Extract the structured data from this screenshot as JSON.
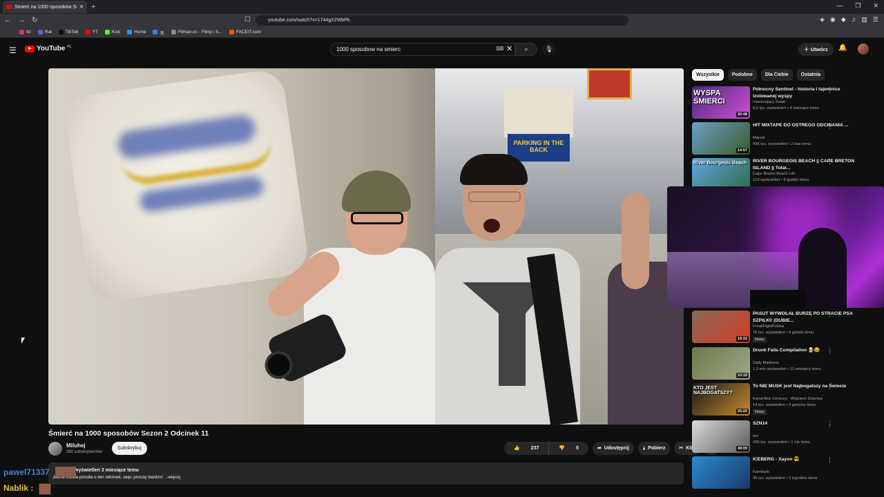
{
  "browser": {
    "tab_title": "Śmierć na 1000 sposobów Se",
    "url": "youtube.com/watch?v=1744gX2WbPk",
    "bookmarks": [
      {
        "label": "IG",
        "color": "#e1306c"
      },
      {
        "label": "Rat",
        "color": "#6a5acd"
      },
      {
        "label": "TikTok",
        "color": "#111111"
      },
      {
        "label": "YT",
        "color": "#ff0000"
      },
      {
        "label": "Kick",
        "color": "#53fc18"
      },
      {
        "label": "Home",
        "color": "#1d9bf0"
      },
      {
        "label": "天",
        "color": "#3b82f6"
      },
      {
        "label": "Filman.cc - Filmy i S...",
        "color": "#888888"
      },
      {
        "label": "FACEIT.com",
        "color": "#ff5500"
      }
    ]
  },
  "yt": {
    "logo": "YouTube",
    "region": "PL",
    "search_value": "1000 sposobow na smierc",
    "create_label": "Utwórz"
  },
  "video": {
    "sign_text": "PARKING IN THE BACK",
    "title": "Śmierć na 1000 sposobów Sezon 2 Odcinek 11",
    "channel": "Miluhej",
    "subscribers": "392 subskrybentów",
    "subscribe_label": "Subskrybuj",
    "likes": "237",
    "dislikes": "5",
    "share_label": "Udostępnij",
    "download_label": "Pobierz",
    "clip_label": "Klip",
    "desc_meta": "wyświetleń  3 miesiące temu",
    "desc_text": "Jedna osoba prosiła o ten odcinek, więc proszę bardzo! ...więcej"
  },
  "chat": {
    "user1": "pawel71337",
    "user2": "Nablik :"
  },
  "chips": [
    "Wszystkie",
    "Podobne",
    "Dla Ciebie",
    "Ostatnio"
  ],
  "recommendations": [
    {
      "title": "Północny Sentinel - historia i tajemnice izolowanej wyspy",
      "channel": "Interesujący Świat",
      "meta": "9,2 tys. wyświetleń • 4 miesiące temu",
      "duration": "30:48",
      "thumb_text": "WYSPA ŚMIERCI",
      "c1": "#4a2a7a",
      "c2": "#d04fd9",
      "badge": ""
    },
    {
      "title": "HIT MIXTAPE DO OSTREGO ODCINANIA ...",
      "channel": "Marcel",
      "meta": "436 tys. wyświetleń • 2 lata temu",
      "duration": "14:57",
      "thumb_text": "",
      "c1": "#6aa0c8",
      "c2": "#3a5a2a",
      "badge": ""
    },
    {
      "title": "RIVER BOURGEOIS  BEACH || CAPE BRETON ISLAND || Total...",
      "channel": "Cape Breton Beach Life",
      "meta": "219 wyświetleń • 9 godzin temu",
      "duration": "",
      "thumb_text": "River Bourgeois Beach",
      "c1": "#5ea8e0",
      "c2": "#2f6b4a",
      "badge": ""
    },
    {
      "title": "PASUT WYWOŁAŁ BURZĘ PO STRACIE PSA SZPILKI! (DUBIE...",
      "channel": "FreakFightPolska",
      "meta": "76 tys. wyświetleń • 5 godzin temu",
      "duration": "18:22",
      "thumb_text": "",
      "c1": "#8a6a55",
      "c2": "#d23a2a",
      "badge": "Nowy"
    },
    {
      "title": "Drunk Fails Compilation 🍺😂",
      "channel": "Daily Madness",
      "meta": "1,3 mln wyświetleń • 11 miesięcy temu",
      "duration": "10:19",
      "thumb_text": "",
      "c1": "#6a7a4a",
      "c2": "#a0a88a",
      "badge": ""
    },
    {
      "title": "To NIE MUSK jest Najbogatszy na Świecie",
      "channel": "Kanał Bez Cenzury - Wojciech Dzierwa",
      "meta": "14 tys. wyświetleń • 3 godziny temu",
      "duration": "25:20",
      "thumb_text": "KTO JEST NAJBOGATSZY?",
      "c1": "#1a1a1a",
      "c2": "#c88a2a",
      "badge": "Nowy"
    },
    {
      "title": "SZN14",
      "channel": "eio",
      "meta": "265 tys. wyświetleń • 1 rok temu",
      "duration": "49:09",
      "thumb_text": "",
      "c1": "#dcdcdc",
      "c2": "#5a5a5a",
      "badge": ""
    },
    {
      "title": "ICEBERG - Xayoo 😎",
      "channel": "Kamilqek",
      "meta": "95 tys. wyświetleń • 3 tygodnie temu",
      "duration": "",
      "thumb_text": "",
      "c1": "#2a8ad0",
      "c2": "#1a3a6a",
      "badge": ""
    }
  ]
}
